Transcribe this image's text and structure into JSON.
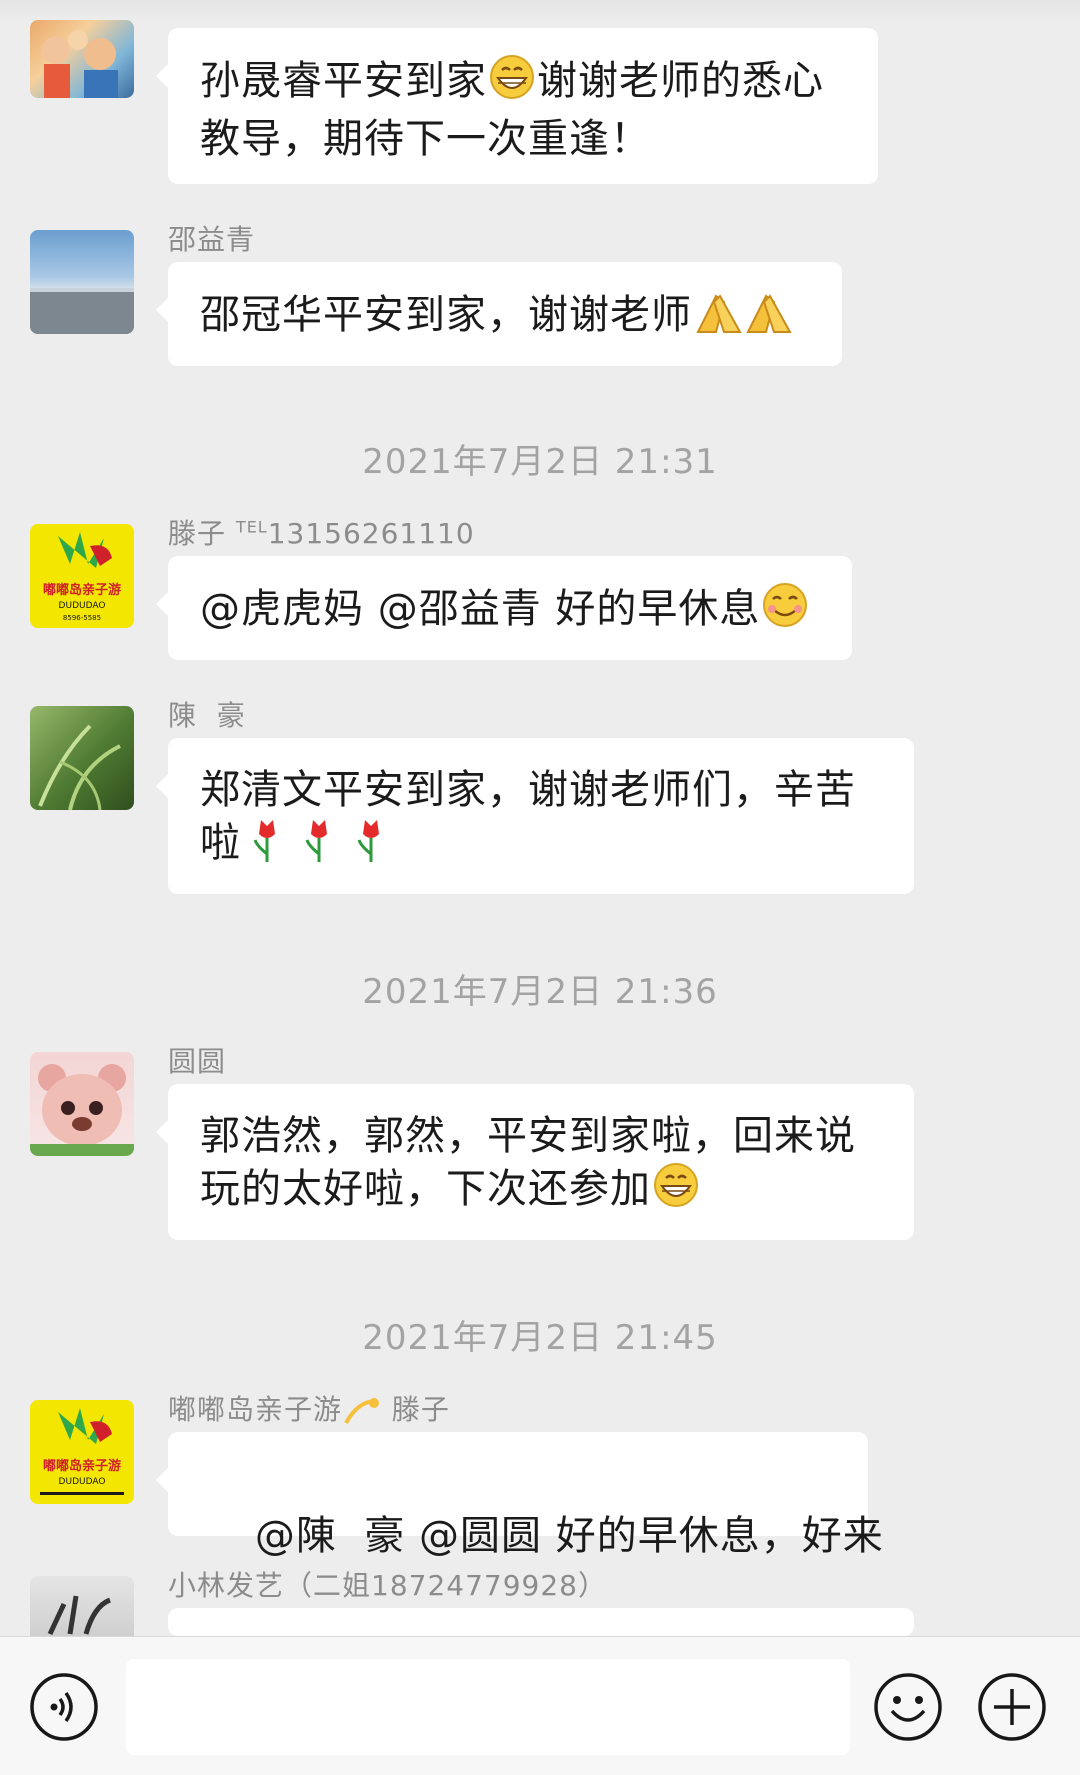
{
  "messages": [
    {
      "id": "m1",
      "sender": "",
      "text_lines": [
        "孙晟睿平安到家",
        "谢谢老师的悉心",
        "教导，期待下一次重逢！"
      ],
      "emoji": "grin-emoji"
    },
    {
      "id": "m2",
      "sender": "邵益青",
      "text": "邵冠华平安到家，谢谢老师",
      "emoji": "pray-emoji"
    },
    {
      "id": "t1",
      "time": "2021年7月2日 21:31"
    },
    {
      "id": "m3",
      "sender": "滕子",
      "sender_tel": "TEL",
      "sender_phone": "13156261110",
      "text": "@虎虎妈 @邵益青 好的早休息",
      "emoji": "smile-emoji"
    },
    {
      "id": "m4",
      "sender": "陳  豪",
      "text_lines": [
        "郑清文平安到家，谢谢老师们，辛苦",
        "啦"
      ],
      "emoji": "tulip-emoji"
    },
    {
      "id": "t2",
      "time": "2021年7月2日 21:36"
    },
    {
      "id": "m5",
      "sender": "圆圆",
      "text_lines": [
        "郭浩然，郭然，平安到家啦，回来说",
        "玩的太好啦，下次还参加"
      ],
      "emoji": "grin-emoji"
    },
    {
      "id": "t3",
      "time": "2021年7月2日 21:45"
    },
    {
      "id": "m6",
      "sender_prefix": "嘟嘟岛亲子游",
      "sender_suffix": "滕子",
      "text": "@陳  豪 @圆圆 好的早休息，好来",
      "emoji": "comet-emoji"
    },
    {
      "id": "m7",
      "sender": "小林发艺（二姐18724779928）"
    }
  ],
  "avatars": {
    "m3": {
      "line1": "嘟嘟岛亲子游",
      "line2": "DUDUDAO",
      "line3": "8596-5585"
    },
    "m6": {
      "line1": "嘟嘟岛亲子游",
      "line2": "DUDUDAO"
    }
  },
  "input_bar": {
    "icons": [
      "voice-icon",
      "emoji-icon",
      "plus-icon"
    ],
    "text_value": ""
  },
  "colors": {
    "background": "#ededed",
    "bubble": "#ffffff",
    "timestamp": "#a3a3a3",
    "sender": "#8c8c8c",
    "logo_yellow": "#f3e600",
    "logo_red": "#d0202a"
  }
}
